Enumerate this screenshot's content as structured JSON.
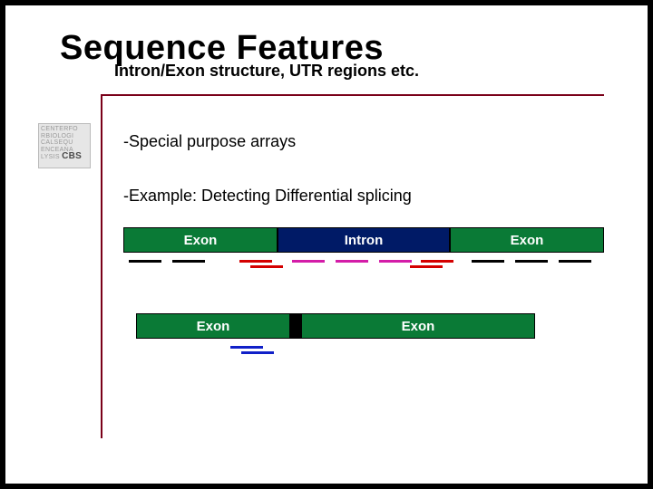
{
  "title": "Sequence Features",
  "subtitle": "Intron/Exon structure, UTR regions etc.",
  "logo": {
    "line1": "CENTERFO",
    "line2": "RBIOLOGI",
    "line3": "CALSEQU",
    "line4": "ENCEANA",
    "line5": "LYSIS",
    "big": "CBS"
  },
  "bullets": {
    "b1": "-Special purpose arrays",
    "b2": "-Example: Detecting Differential splicing"
  },
  "labels": {
    "exon": "Exon",
    "intron": "Intron"
  }
}
